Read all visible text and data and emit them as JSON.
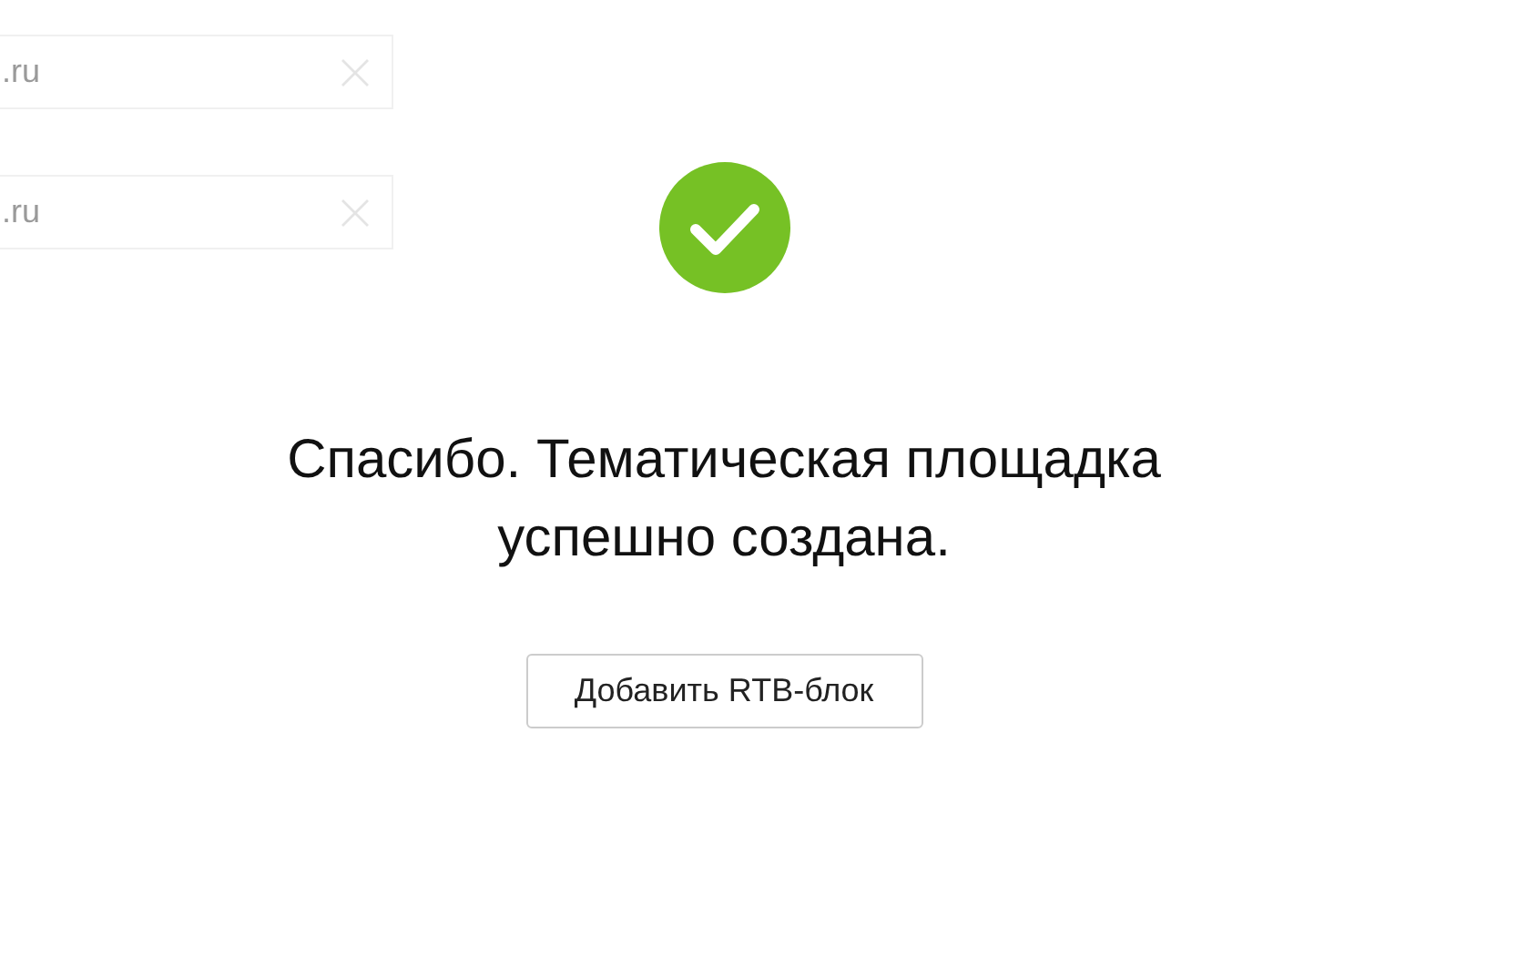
{
  "background_fields": [
    {
      "value": ".ru"
    },
    {
      "value": ".ru"
    }
  ],
  "success": {
    "message": "Спасибо. Тематическая площадка успешно создана.",
    "button": "Добавить RTB-блок"
  }
}
